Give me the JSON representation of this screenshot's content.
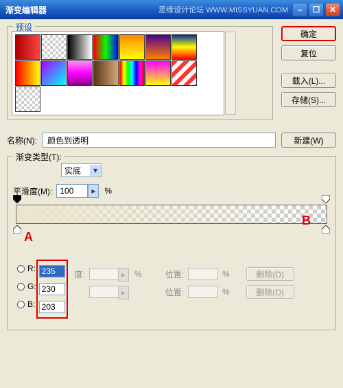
{
  "titlebar": {
    "title": "渐变编辑器",
    "watermark": "思缘设计论坛  WWW.MISSYUAN.COM"
  },
  "presets": {
    "label": "预设"
  },
  "buttons": {
    "ok": "确定",
    "reset": "复位",
    "load": "载入(L)...",
    "save": "存储(S)...",
    "new": "新建(W)",
    "delete": "删除(D)"
  },
  "name": {
    "label": "名称(N):",
    "value": "颜色到透明"
  },
  "gradient": {
    "type_label": "渐变类型(T):",
    "type_value": "实底",
    "smooth_label": "平滑度(M):",
    "smooth_value": "100",
    "percent": "%",
    "pos_label": "位置:",
    "opacity_label_short": "度:"
  },
  "rgb": {
    "r_label": "R:",
    "g_label": "G:",
    "b_label": "B:",
    "r": "235",
    "g": "230",
    "b": "203"
  },
  "markers": {
    "a": "A",
    "b": "B"
  },
  "swatches": [
    "linear-gradient(to right,#a00,#f44)",
    "repeating-conic-gradient(#ccc 0 25%,#fff 0 50%) 0 0/8px 8px",
    "linear-gradient(to right,#000,#fff)",
    "linear-gradient(to right,#f00,#0f0,#00f)",
    "linear-gradient(to bottom,#f80,#ff0)",
    "linear-gradient(to bottom,#520090,#ff8000)",
    "linear-gradient(to bottom,#0030a0,#ff0,#f00)",
    "linear-gradient(to right,#f00,#ff0)",
    "linear-gradient(135deg,#a0f,#0ff)",
    "linear-gradient(to bottom,#f8f,#f0f,#808)",
    "linear-gradient(to right,#5a3618,#d4a679)",
    "linear-gradient(to right,#f00,#ff0,#0f0,#0ff,#00f,#f0f,#f00)",
    "linear-gradient(to bottom,#f0f,#ff0)",
    "repeating-linear-gradient(135deg,#f33 0 6px,#fff 6px 12px)",
    "repeating-conic-gradient(#ccc 0 25%,#fff 0 50%) 0 0/8px 8px"
  ]
}
